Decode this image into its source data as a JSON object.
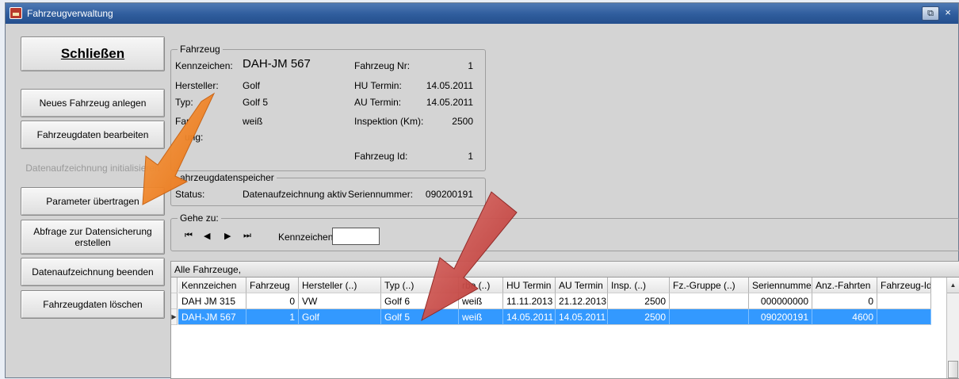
{
  "window": {
    "title": "Fahrzeugverwaltung",
    "restore_icon": "restore-icon",
    "close_glyph": "×"
  },
  "sidebar": {
    "close": "Schließen",
    "new_vehicle": "Neues Fahrzeug anlegen",
    "edit_vehicle": "Fahrzeugdaten bearbeiten",
    "init_recording": "Datenaufzeichnung initialisieren",
    "transfer_params": "Parameter übertragen",
    "backup_query_line1": "Abfrage zur Datensicherung",
    "backup_query_line2": "erstellen",
    "end_recording": "Datenaufzeichnung beenden",
    "delete_vehicle": "Fahrzeugdaten löschen"
  },
  "vehicle": {
    "legend": "Fahrzeug",
    "plate_label": "Kennzeichen:",
    "plate_value": "DAH-JM 567",
    "nr_label": "Fahrzeug Nr:",
    "nr_value": "1",
    "maker_label": "Hersteller:",
    "maker_value": "Golf",
    "hu_label": "HU Termin:",
    "hu_value": "14.05.2011",
    "type_label": "Typ:",
    "type_value": "Golf 5",
    "au_label": "AU Termin:",
    "au_value": "14.05.2011",
    "color_label": "Far",
    "color_value": "weiß",
    "insp_label": "Inspektion (Km):",
    "insp_value": "2500",
    "note_label": "ung:",
    "id_label": "Fahrzeug Id:",
    "id_value": "1"
  },
  "recorder": {
    "legend": "ahrzeugdatenspeicher",
    "status_label": "Status:",
    "status_value": "Datenaufzeichnung aktiv",
    "serial_label": "Seriennummer:",
    "serial_value": "090200191"
  },
  "goto": {
    "legend": "Gehe zu:",
    "first": "⏮",
    "prev": "◀",
    "next": "▶",
    "last": "⏭",
    "plate_label": "Kennzeichen:",
    "plate_value": ""
  },
  "grid": {
    "title": "Alle Fahrzeuge,",
    "columns": [
      "Kennzeichen",
      "Fahrzeug",
      "Hersteller (..)",
      "Typ (..)",
      "rbe (..)",
      "HU Termin",
      "AU Termin",
      "Insp. (..)",
      "Fz.-Gruppe (..)",
      "Seriennummer",
      "Anz.-Fahrten",
      "Fahrzeug-Id."
    ],
    "rows": [
      [
        "DAH JM 315",
        "0",
        "VW",
        "Golf 6",
        "weiß",
        "11.11.2013",
        "21.12.2013",
        "2500",
        "",
        "000000000",
        "0",
        ""
      ],
      [
        "DAH-JM 567",
        "1",
        "Golf",
        "Golf 5",
        "weiß",
        "14.05.2011",
        "14.05.2011",
        "2500",
        "",
        "090200191",
        "4600",
        ""
      ]
    ],
    "selected_row": 1,
    "row_marker": "▶",
    "scroll_up": "▲"
  },
  "colors": {
    "selection": "#3399ff",
    "arrow_orange": "#f07f1a",
    "arrow_red": "#c9413d",
    "titlebar": "#2f5d9d"
  }
}
